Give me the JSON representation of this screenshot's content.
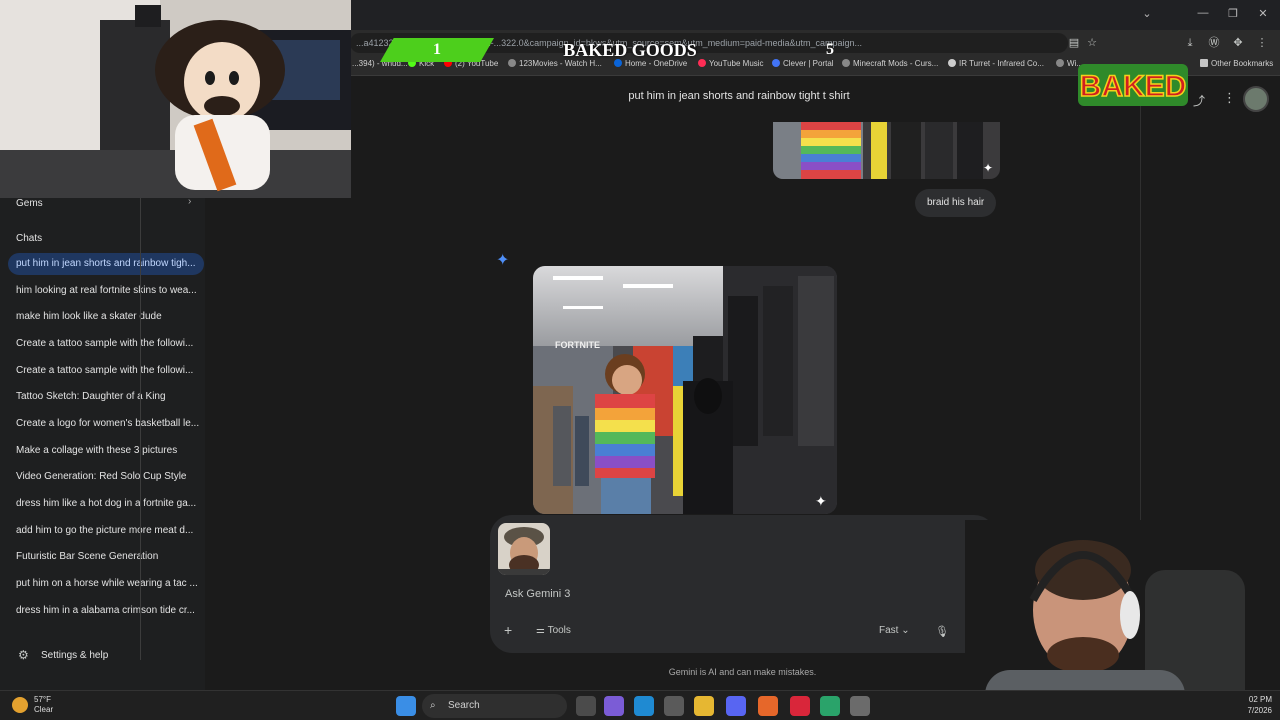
{
  "browser": {
    "url": "...a412322b...android-min-version-...322.0&campaign_id=bkws&utm_source=sem&utm_medium=paid-media&utm_campaign...",
    "bookmarks": [
      {
        "label": "...394) - whud..."
      },
      {
        "label": "Kick"
      },
      {
        "label": "(2) YouTube"
      },
      {
        "label": "123Movies - Watch H..."
      },
      {
        "label": "Home - OneDrive"
      },
      {
        "label": "YouTube Music"
      },
      {
        "label": "Clever | Portal"
      },
      {
        "label": "Minecraft Mods - Curs..."
      },
      {
        "label": "IR Turret - Infrared Co..."
      },
      {
        "label": "Wi..."
      }
    ],
    "other_bookmarks": "Other Bookmarks"
  },
  "overlay": {
    "score_left": "1",
    "title": "BAKED GOODS",
    "score_right": "5",
    "logo_text": "BAKED"
  },
  "sidebar": {
    "gems_label": "Gems",
    "chats_label": "Chats",
    "chats": [
      "put him in jean shorts and rainbow tigh...",
      "him looking at real fortnite skins to wea...",
      "make him look like a skater dude",
      "Create a tattoo sample with the followi...",
      "Create a tattoo sample with the followi...",
      "Tattoo Sketch: Daughter of a King",
      "Create a logo for women's basketball le...",
      "Make a collage with these 3 pictures",
      "Video Generation: Red Solo Cup Style",
      "dress him like a hot dog in a fortnite ga...",
      "add him to go the picture more meat d...",
      "Futuristic Bar Scene Generation",
      "put him on a horse while wearing a tac ...",
      "dress him in a alabama crimson tide cr..."
    ],
    "settings_label": "Settings & help"
  },
  "conversation": {
    "prompt_title": "put him in jean shorts and rainbow tight t shirt",
    "user_message": "braid his hair",
    "image_store_sign": "FORTNITE"
  },
  "composer": {
    "placeholder": "Ask Gemini 3",
    "tools_label": "Tools",
    "mode_label": "Fast"
  },
  "footer": {
    "disclaimer": "Gemini is AI and can make mistakes."
  },
  "taskbar": {
    "weather_temp": "57°F",
    "weather_desc": "Clear",
    "search_label": "Search",
    "time": "02 PM",
    "date": "7/2026"
  },
  "colors": {
    "active_chat_bg": "#1f3760",
    "accent_blue": "#4f8ff7",
    "score_green": "#4dcf1c"
  }
}
